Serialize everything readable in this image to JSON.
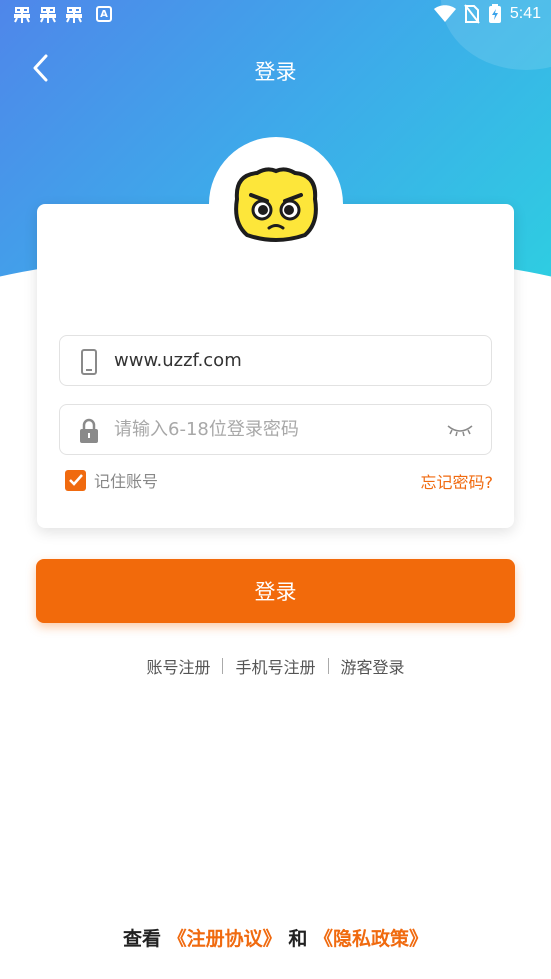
{
  "status_bar": {
    "time": "5:41",
    "notification_icons": [
      "app-icon",
      "app-icon",
      "app-icon",
      "a-icon"
    ],
    "system_icons": [
      "wifi-icon",
      "no-sim-icon",
      "battery-charging-icon"
    ]
  },
  "nav": {
    "title": "登录",
    "back_icon": "chevron-left-icon"
  },
  "login_form": {
    "phone_value": "www.uzzf.com",
    "password_placeholder": "请输入6-18位登录密码",
    "remember_label": "记住账号",
    "remember_checked": true,
    "forgot_label": "忘记密码?"
  },
  "login_button": {
    "label": "登录"
  },
  "links": {
    "account_register": "账号注册",
    "phone_register": "手机号注册",
    "guest_login": "游客登录"
  },
  "agreement": {
    "prefix": "查看",
    "terms": "《注册协议》",
    "and": "和",
    "privacy": "《隐私政策》"
  },
  "colors": {
    "accent": "#f26a0b",
    "header_gradient_start": "#4f86ea",
    "header_gradient_end": "#2cd2e0"
  }
}
